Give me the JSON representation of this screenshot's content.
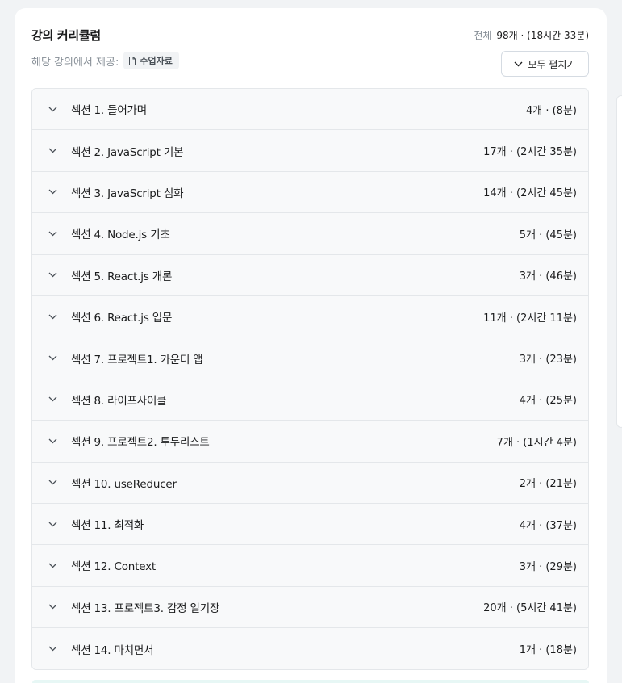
{
  "curriculum": {
    "title": "강의 커리큘럼",
    "summary_label": "전체",
    "summary_value": "98개 · (18시간 33분)",
    "provided_label": "해당 강의에서 제공:",
    "provided_chip": "수업자료",
    "expand_all_label": "모두 펼치기",
    "sections": [
      {
        "name": "섹션 1. 들어가며",
        "meta": "4개 · (8분)"
      },
      {
        "name": "섹션 2. JavaScript 기본",
        "meta": "17개 · (2시간 35분)"
      },
      {
        "name": "섹션 3. JavaScript 심화",
        "meta": "14개 · (2시간 45분)"
      },
      {
        "name": "섹션 4. Node.js 기초",
        "meta": "5개 · (45분)"
      },
      {
        "name": "섹션 5. React.js 개론",
        "meta": "3개 · (46분)"
      },
      {
        "name": "섹션 6. React.js 입문",
        "meta": "11개 · (2시간 11분)"
      },
      {
        "name": "섹션 7. 프로젝트1. 카운터 앱",
        "meta": "3개 · (23분)"
      },
      {
        "name": "섹션 8. 라이프사이클",
        "meta": "4개 · (25분)"
      },
      {
        "name": "섹션 9. 프로젝트2. 투두리스트",
        "meta": "7개 · (1시간 4분)"
      },
      {
        "name": "섹션 10. useReducer",
        "meta": "2개 · (21분)"
      },
      {
        "name": "섹션 11. 최적화",
        "meta": "4개 · (37분)"
      },
      {
        "name": "섹션 12. Context",
        "meta": "3개 · (29분)"
      },
      {
        "name": "섹션 13. 프로젝트3. 감정 일기장",
        "meta": "20개 · (5시간 41분)"
      },
      {
        "name": "섹션 14. 마치면서",
        "meta": "1개 · (18분)"
      }
    ]
  },
  "icons": {
    "chip": "document-icon",
    "expand": "chevron-down-icon",
    "row": "chevron-down-icon"
  },
  "colors": {
    "muted": "#868e96",
    "row_bg": "#f8f9fa",
    "border": "#e4e7ea"
  }
}
